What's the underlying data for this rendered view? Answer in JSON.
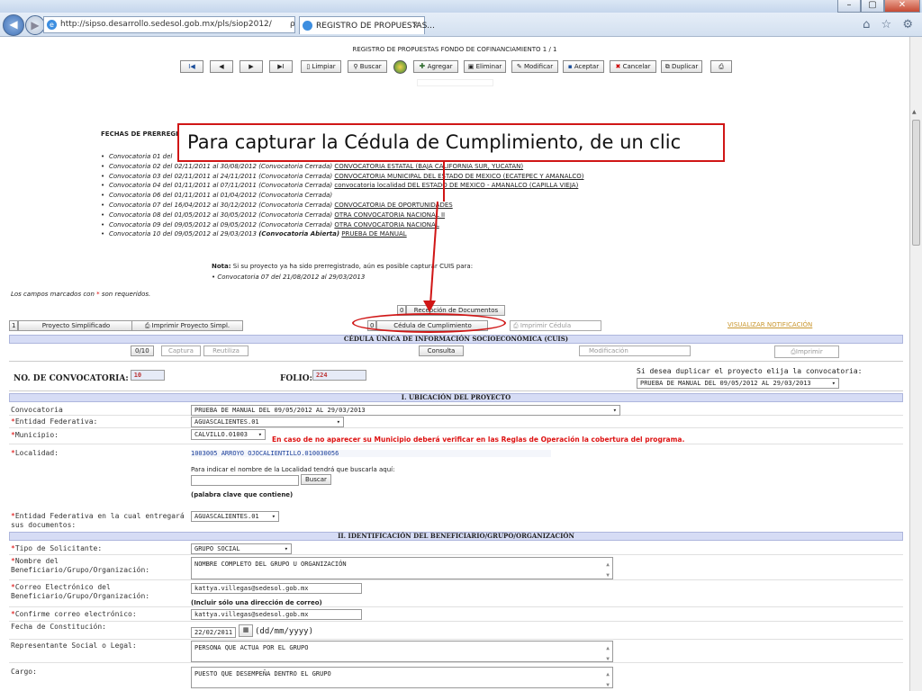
{
  "browser": {
    "window_controls": [
      "–",
      "▢",
      "✕"
    ],
    "back_icon": "◀",
    "forward_icon": "▶",
    "address": "http://sipso.desarrollo.sedesol.gob.mx/pls/siop2012/",
    "address_tools": "ρ ▾ ⊠ C ✕",
    "tab_title": "REGISTRO DE PROPUESTAS...",
    "tab_close": "✕",
    "right_icons": "⌂ ☆ ⚙"
  },
  "page": {
    "title": "REGISTRO DE PROPUESTAS FONDO DE COFINANCIAMIENTO 1 / 1",
    "toolbar": {
      "first": "I◀",
      "prev": "◀",
      "next": "▶",
      "last": "▶I",
      "limpiar": "Limpiar",
      "buscar": "Buscar",
      "agregar": "Agregar",
      "eliminar": "Eliminar",
      "modificar": "Modificar",
      "aceptar": "Aceptar",
      "cancelar": "Cancelar",
      "duplicar": "Duplicar"
    },
    "fechas_heading": "FECHAS DE PRERREGISTRO",
    "convocatorias": [
      {
        "text": "Convocatoria 01 del ",
        "link": ""
      },
      {
        "text": "Convocatoria 02 del 02/11/2011 al 30/08/2012 (Convocatoria Cerrada) ",
        "link": "CONVOCATORIA ESTATAL (BAJA CALIFORNIA SUR, YUCATAN)"
      },
      {
        "text": "Convocatoria 03 del 02/11/2011 al 24/11/2011 (Convocatoria Cerrada) ",
        "link": "CONVOCATORIA MUNICIPAL DEL ESTADO DE MEXICO (ECATEPEC Y AMANALCO)"
      },
      {
        "text": "Convocatoria 04 del 01/11/2011 al 07/11/2011 (Convocatoria Cerrada) ",
        "link": "convocatoria localidad DEL ESTADO DE MEXICO - AMANALCO (CAPILLA VIEJA)"
      },
      {
        "text": "Convocatoria 06 del 01/11/2011 al 01/04/2012 (Convocatoria Cerrada)",
        "link": ""
      },
      {
        "text": "Convocatoria 07 del 16/04/2012 al 30/12/2012 (Convocatoria Cerrada) ",
        "link": "CONVOCATORIA DE OPORTUNIDADES"
      },
      {
        "text": "Convocatoria 08 del 01/05/2012 al 30/05/2012 (Convocatoria Cerrada) ",
        "link": "OTRA CONVOCATORIA NACIONAL II"
      },
      {
        "text": "Convocatoria 09 del 09/05/2012 al 09/05/2012 (Convocatoria Cerrada) ",
        "link": "OTRA CONVOCATORIA NACIONAL"
      }
    ],
    "conv10": {
      "text": "Convocatoria 10 del 09/05/2012 al 29/03/2013 ",
      "bold": "(Convocatoria Abierta)",
      "link": "PRUEBA DE MANUAL"
    },
    "nota_label": "Nota:",
    "nota_text": " Si su proyecto ya ha sido prerregistrado, aún es posible capturar CUIS para:",
    "nota_item": "Convocatoria 07 del 21/08/2012 al 29/03/2013",
    "required_note_a": "Los campos marcados con ",
    "required_note_b": " son requeridos.",
    "req_mark": "*",
    "callout": "Para capturar la Cédula de Cumplimiento, de un clic",
    "recepcion_count": "0",
    "recepcion_label": "Recepción de Documentos",
    "simplificado_count": "1",
    "simplificado_label": "Proyecto Simplificado",
    "imprimir_simpl": "Imprimir Proyecto Simpl.",
    "cedula_count": "0",
    "cedula_label": "Cédula de Cumplimiento",
    "imprimir_cedula": "Imprimir Cédula",
    "visualizar": "VISUALIZAR NOTIFICACIÓN",
    "cuis_title": "CÉDULA ÚNICA DE INFORMACIÓN SOCIOECONÓMICA (CUIS)",
    "cuis_count": "0/10",
    "captura": "Captura",
    "reutiliza": "Reutiliza",
    "consulta": "Consulta",
    "modificacion": "Modificación",
    "imprimir": "Imprimir",
    "no_conv_label": "NO. DE CONVOCATORIA:",
    "no_conv_value": "10",
    "folio_label": "FOLIO:",
    "folio_value": "224",
    "duplicar_text": "Si desea duplicar el proyecto elija la convocatoria:",
    "duplicar_select": "PRUEBA DE MANUAL DEL 09/05/2012 AL 29/03/2013",
    "sec1": "I. UBICACIÓN DEL PROYECTO",
    "convocatoria_label": "Convocatoria",
    "convocatoria_value": "PRUEBA DE MANUAL DEL 09/05/2012 AL 29/03/2013",
    "entidad_label": "Entidad Federativa:",
    "entidad_value": "AGUASCALIENTES.01",
    "municipio_label": "Municipio:",
    "municipio_value": "CALVILLO.01003",
    "municipio_warning": "En caso de no aparecer su Municipio deberá verificar en las Reglas de Operación la cobertura del programa.",
    "localidad_label": "Localidad:",
    "localidad_value": "1003005 ARROYO OJOCALIENTILLO.010030056",
    "localidad_hint": "Para indicar el nombre de la Localidad tendrá que buscarla aquí:",
    "buscar_btn": "Buscar",
    "palabra_clave": "(palabra clave que contiene)",
    "entrega_label_a": "Entidad Federativa en la cual entregará",
    "entrega_label_b": "sus documentos:",
    "entrega_value": "AGUASCALIENTES.01",
    "sec2": "II. IDENTIFICACIÓN DEL BENEFICIARIO/GRUPO/ORGANIZACIÓN",
    "tipo_label": "Tipo de Solicitante:",
    "tipo_value": "GRUPO SOCIAL",
    "nombre_label_a": "Nombre del",
    "nombre_label_b": "Beneficiario/Grupo/Organización:",
    "nombre_value": "NOMBRE COMPLETO DEL GRUPO U ORGANIZACIÓN",
    "correo_label_a": "Correo Electrónico del",
    "correo_label_b": "Beneficiario/Grupo/Organización:",
    "correo_value": "kattya.villegas@sedesol.gob.mx",
    "correo_hint": "(Incluir sólo una dirección de correo)",
    "confirme_label": "Confirme correo electrónico:",
    "confirme_value": "kattya.villegas@sedesol.gob.mx",
    "fecha_label": "Fecha de Constitución:",
    "fecha_value": "22/02/2011",
    "fecha_format": "(dd/mm/yyyy)",
    "representante_label": "Representante Social o Legal:",
    "representante_value": "PERSONA QUE ACTUA POR EL GRUPO",
    "cargo_label": "Cargo:",
    "cargo_value": "PUESTO QUE DESEMPEÑA DENTRO EL GRUPO"
  }
}
